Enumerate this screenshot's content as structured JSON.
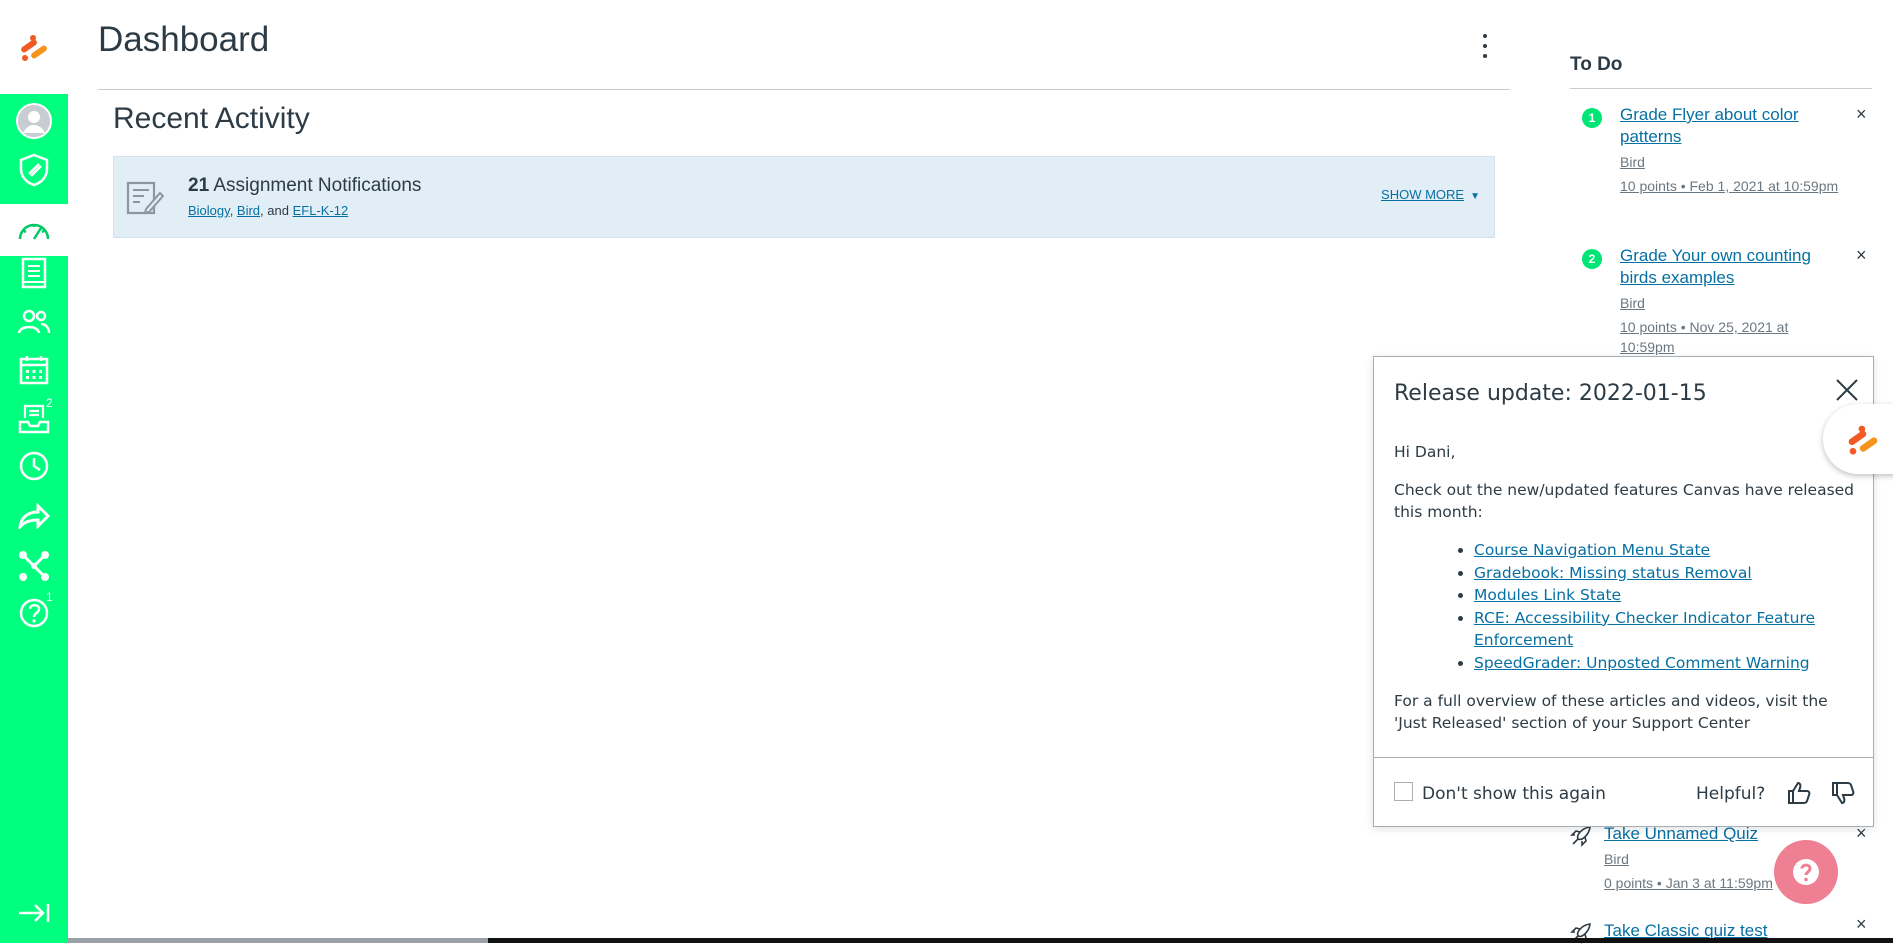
{
  "header": {
    "title": "Dashboard"
  },
  "nav": {
    "items": [
      {
        "name": "account",
        "badge": ""
      },
      {
        "name": "admin",
        "badge": ""
      },
      {
        "name": "dashboard",
        "badge": ""
      },
      {
        "name": "courses",
        "badge": ""
      },
      {
        "name": "groups",
        "badge": ""
      },
      {
        "name": "calendar",
        "badge": ""
      },
      {
        "name": "inbox",
        "badge": "2"
      },
      {
        "name": "history",
        "badge": ""
      },
      {
        "name": "commons",
        "badge": ""
      },
      {
        "name": "studio",
        "badge": ""
      },
      {
        "name": "help",
        "badge": "1"
      }
    ]
  },
  "recent_activity": {
    "title": "Recent Activity",
    "count": "21",
    "label": "Assignment Notifications",
    "courses": [
      "Biology",
      "Bird",
      "EFL-K-12"
    ],
    "sep1": ", ",
    "sep2": ", and ",
    "show_more": "SHOW MORE"
  },
  "todo": {
    "title": "To Do",
    "items": [
      {
        "num": "1",
        "title": "Grade Flyer about color patterns",
        "course": "Bird",
        "meta": "10 points • Feb 1, 2021 at 10:59pm"
      },
      {
        "num": "2",
        "title": "Grade Your own counting birds examples",
        "course": "Bird",
        "meta": "10 points • Nov 25, 2021 at 10:59pm"
      },
      {
        "num": "",
        "title": "Take Unnamed Quiz",
        "course": "Bird",
        "meta": "0 points • Jan 3 at 11:59pm"
      },
      {
        "num": "",
        "title": "Take Classic quiz test",
        "course": "",
        "meta": ""
      }
    ],
    "close_glyph": "×"
  },
  "popover": {
    "title": "Release update: 2022-01-15",
    "greeting": "Hi Dani,",
    "intro": "Check out the new/updated features Canvas have released this month:",
    "links": [
      "Course Navigation Menu State",
      "Gradebook: Missing status Removal",
      "Modules Link State",
      "RCE: Accessibility Checker Indicator Feature Enforcement",
      "SpeedGrader: Unposted Comment Warning"
    ],
    "outro": "For a full overview of these articles and videos, visit the 'Just Released' section of your Support Center",
    "dont_show": "Don't show this again",
    "helpful": "Helpful?"
  },
  "help_fab": {
    "glyph": "?"
  },
  "colors": {
    "nav": "#00ff7f",
    "todo_badge": "#00e676",
    "link": "#0770a3",
    "fab": "#ef7f92",
    "brand_orange": "#f15a24"
  }
}
